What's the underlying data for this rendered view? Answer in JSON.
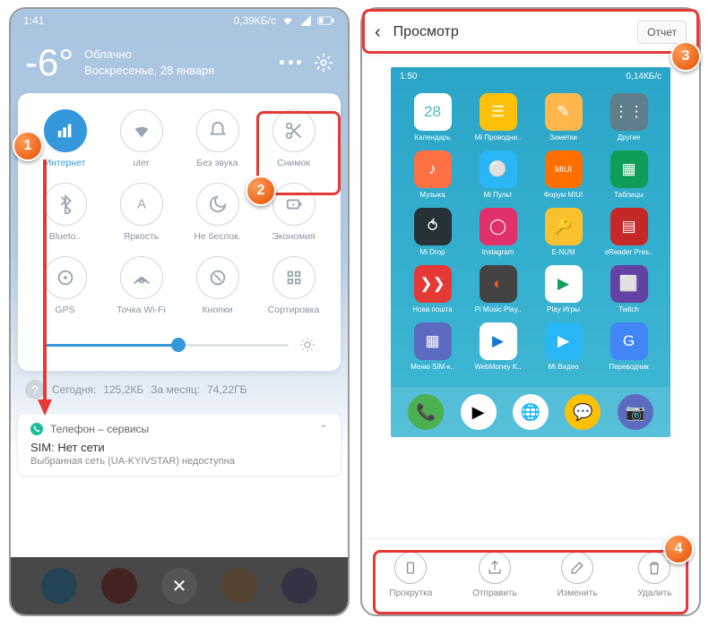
{
  "left": {
    "status": {
      "time": "1:41",
      "speed": "0,39КБ/с"
    },
    "weather": {
      "temp": "-6°",
      "condition": "Облачно",
      "date": "Воскресенье, 28 января"
    },
    "tiles": [
      {
        "label": "Интернет",
        "active": true,
        "icon": "signal"
      },
      {
        "label": "uter",
        "active": false,
        "icon": "wifi"
      },
      {
        "label": "Без звука",
        "active": false,
        "icon": "bell"
      },
      {
        "label": "Снимок",
        "active": false,
        "icon": "scissors"
      },
      {
        "label": "Blueto..",
        "active": false,
        "icon": "bluetooth"
      },
      {
        "label": "Яркость",
        "active": false,
        "icon": "brightness-a"
      },
      {
        "label": "Не беспок.",
        "active": false,
        "icon": "moon"
      },
      {
        "label": "Экономия",
        "active": false,
        "icon": "battery"
      },
      {
        "label": "GPS",
        "active": false,
        "icon": "gps"
      },
      {
        "label": "Точка Wi-Fi",
        "active": false,
        "icon": "hotspot"
      },
      {
        "label": "Кнопки",
        "active": false,
        "icon": "buttons"
      },
      {
        "label": "Сортировка",
        "active": false,
        "icon": "sort"
      }
    ],
    "usage": {
      "today_label": "Сегодня:",
      "today_val": "125,2КБ",
      "month_label": "За месяц:",
      "month_val": "74,22ГБ"
    },
    "notif": {
      "app": "Телефон – сервисы",
      "title": "SIM: Нет сети",
      "body": "Выбранная сеть (UA-KYIVSTAR) недоступна"
    }
  },
  "right": {
    "header": {
      "title": "Просмотр",
      "report": "Отчет"
    },
    "shot_status": {
      "time": "1:50",
      "speed": "0,14КБ/с"
    },
    "apps": [
      [
        {
          "label": "Календарь",
          "bg": "#fff",
          "fg": "#4ab7d4",
          "txt": "28"
        },
        {
          "label": "Mi Проводни..",
          "bg": "#ffc107",
          "fg": "#fff",
          "txt": "☰"
        },
        {
          "label": "Заметки",
          "bg": "#ffb74d",
          "fg": "#fff",
          "txt": "✎"
        },
        {
          "label": "Другие",
          "bg": "#607d8b",
          "fg": "#fff",
          "txt": "⋮⋮"
        }
      ],
      [
        {
          "label": "Музыка",
          "bg": "#ff7043",
          "fg": "#fff",
          "txt": "♪"
        },
        {
          "label": "Mi Пульт",
          "bg": "#29b6f6",
          "fg": "#fff",
          "txt": "⚪"
        },
        {
          "label": "Форум MIUI",
          "bg": "#ff6f00",
          "fg": "#fff",
          "txt": "MIUI"
        },
        {
          "label": "Таблицы",
          "bg": "#0f9d58",
          "fg": "#fff",
          "txt": "▦"
        }
      ],
      [
        {
          "label": "Mi Drop",
          "bg": "#263238",
          "fg": "#fff",
          "txt": "⥀"
        },
        {
          "label": "Instagram",
          "bg": "#e1306c",
          "fg": "#fff",
          "txt": "◯"
        },
        {
          "label": "E-NUM",
          "bg": "#fbc02d",
          "fg": "#333",
          "txt": "🔑"
        },
        {
          "label": "eReader Pres..",
          "bg": "#c62828",
          "fg": "#fff",
          "txt": "▤"
        }
      ],
      [
        {
          "label": "Нова пошта",
          "bg": "#e53935",
          "fg": "#fff",
          "txt": "❯❯"
        },
        {
          "label": "Pi Music Play..",
          "bg": "#424242",
          "fg": "#ff5722",
          "txt": "◐"
        },
        {
          "label": "Play Игры",
          "bg": "#fff",
          "fg": "#0f9d58",
          "txt": "▶"
        },
        {
          "label": "Twitch",
          "bg": "#6441a5",
          "fg": "#fff",
          "txt": "⬜"
        }
      ],
      [
        {
          "label": "Меню SIM-к..",
          "bg": "#5c6bc0",
          "fg": "#fff",
          "txt": "▦"
        },
        {
          "label": "WebMoney K..",
          "bg": "#fff",
          "fg": "#1976d2",
          "txt": "▶"
        },
        {
          "label": "Mi Видео",
          "bg": "#29b6f6",
          "fg": "#fff",
          "txt": "▶"
        },
        {
          "label": "Переводчик",
          "bg": "#4285f4",
          "fg": "#fff",
          "txt": "G"
        }
      ]
    ],
    "dock": [
      {
        "bg": "#4caf50"
      },
      {
        "bg": "#fff"
      },
      {
        "bg": "#fff"
      },
      {
        "bg": "#ffc107"
      },
      {
        "bg": "#5c6bc0"
      }
    ],
    "actions": [
      {
        "label": "Прокрутка",
        "icon": "scroll"
      },
      {
        "label": "Отправить",
        "icon": "share"
      },
      {
        "label": "Изменить",
        "icon": "edit"
      },
      {
        "label": "Удалить",
        "icon": "trash"
      }
    ]
  },
  "markers": {
    "m1": "1",
    "m2": "2",
    "m3": "3",
    "m4": "4"
  }
}
